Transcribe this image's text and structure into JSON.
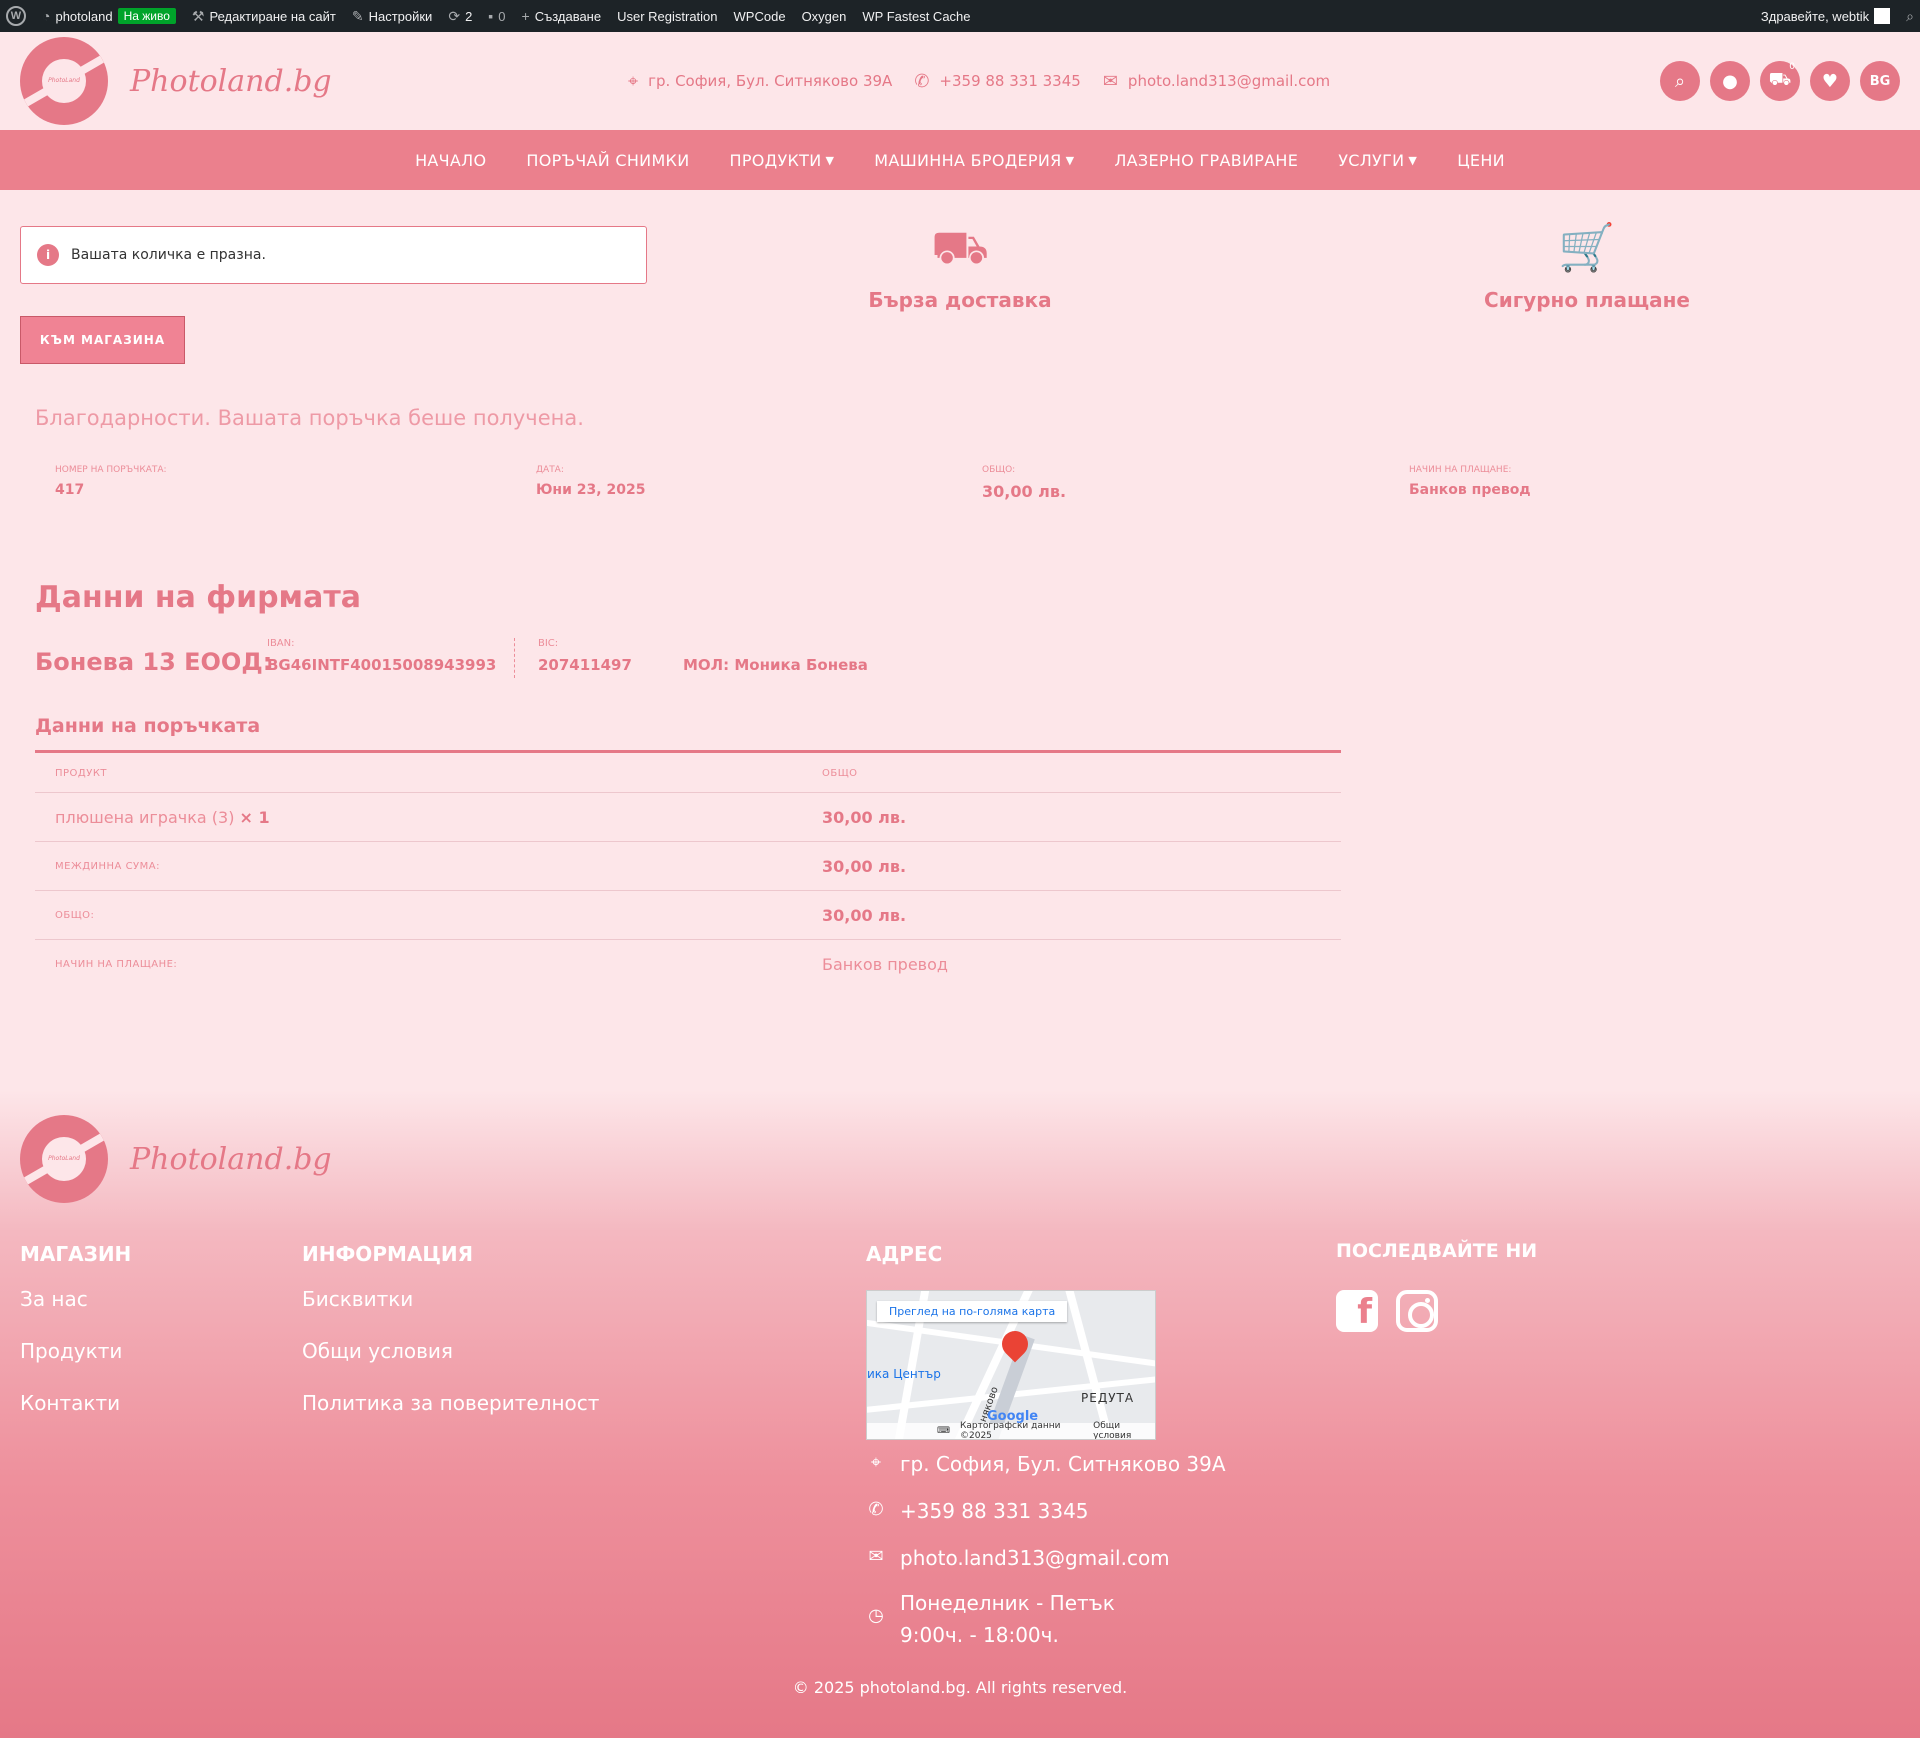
{
  "admin_bar": {
    "site_name": "photoland",
    "live_badge": "На живо",
    "edit_site": "Редактиране на сайт",
    "settings": "Настройки",
    "updates_count": "2",
    "comments_count": "0",
    "create": "Създаване",
    "user_registration": "User Registration",
    "wpcode": "WPCode",
    "oxygen": "Oxygen",
    "fastest_cache": "WP Fastest Cache",
    "greeting": "Здравейте, webtik"
  },
  "header": {
    "logo_mini": "PhotoLand",
    "brand": "Photoland.bg",
    "address": "гр. София, Бул. Ситняково 39А",
    "phone": "+359 88 331 3345",
    "email": "photo.land313@gmail.com",
    "cart_count": "0",
    "lang": "BG"
  },
  "nav": {
    "items": [
      {
        "label": "НАЧАЛО"
      },
      {
        "label": "ПОРЪЧАЙ СНИМКИ"
      },
      {
        "label": "ПРОДУКТИ"
      },
      {
        "label": "МАШИННА БРОДЕРИЯ"
      },
      {
        "label": "ЛАЗЕРНО ГРАВИРАНЕ"
      },
      {
        "label": "УСЛУГИ"
      },
      {
        "label": "ЦЕНИ"
      }
    ]
  },
  "notice": {
    "text": "Вашата количка е празна."
  },
  "shop_button": "КЪМ МАГАЗИНА",
  "features": {
    "delivery": "Бърза доставка",
    "payment": "Сигурно плащане"
  },
  "order": {
    "thanks": "Благодарности. Вашата поръчка беше получена.",
    "number_label": "НОМЕР НА ПОРЪЧКАТА:",
    "number": "417",
    "date_label": "ДАТА:",
    "date": "Юни 23, 2025",
    "total_label": "ОБЩО:",
    "total": "30,00 лв.",
    "method_label": "НАЧИН НА ПЛАЩАНЕ:",
    "method": "Банков превод"
  },
  "firm": {
    "title": "Данни на фирмата",
    "name": "Бонева 13 ЕООД:",
    "iban_label": "IBAN:",
    "iban": "BG46INTF40015008943993",
    "bic_label": "BIC:",
    "bic": "207411497",
    "mol": "МОЛ: Моника Бонева"
  },
  "order_details": {
    "title": "Данни на поръчката",
    "col_product": "ПРОДУКТ",
    "col_total": "ОБЩО",
    "product_name": "плюшена играчка (3)",
    "product_qty": "× 1",
    "product_total": "30,00 лв.",
    "subtotal_label": "МЕЖДИННА СУМА:",
    "subtotal": "30,00 лв.",
    "total_label": "ОБЩО:",
    "total": "30,00 лв.",
    "method_label": "НАЧИН НА ПЛАЩАНЕ:",
    "method": "Банков превод"
  },
  "footer": {
    "logo_mini": "PhotoLand",
    "brand": "Photoland.bg",
    "shop_title": "МАГАЗИН",
    "shop_links": [
      "За нас",
      "Продукти",
      "Контакти"
    ],
    "info_title": "ИНФОРМАЦИЯ",
    "info_links": [
      "Бисквитки",
      "Общи условия",
      "Политика за поверителност"
    ],
    "address_title": "АДРЕС",
    "map_button": "Преглед на по-голяма карта",
    "map_place": "ика Център",
    "map_area": "РЕДУТА",
    "map_street": "няково",
    "map_logo": "Google",
    "map_data": "Картографски данни ©2025",
    "map_terms": "Общи условия",
    "address": "гр. София, Бул. Ситняково 39А",
    "phone": "+359 88 331 3345",
    "email": "photo.land313@gmail.com",
    "hours_line1": "Понеделник - Петък",
    "hours_line2": "9:00ч. - 18:00ч.",
    "follow_title": "ПОСЛЕДВАЙТЕ НИ",
    "copyright": "© 2025 photoland.bg. All rights reserved."
  }
}
